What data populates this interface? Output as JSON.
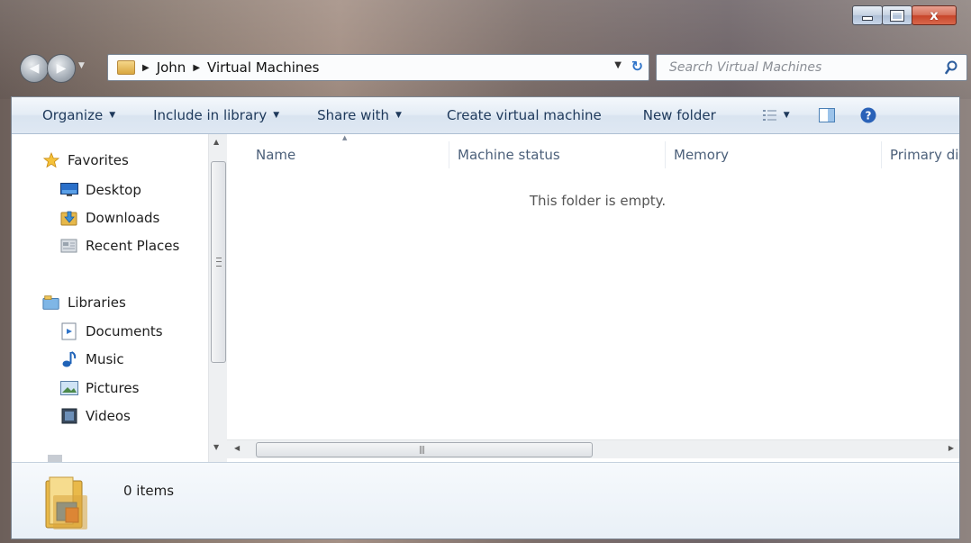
{
  "window": {
    "caption_close": "x"
  },
  "address_bar": {
    "crumbs": [
      "John",
      "Virtual Machines"
    ]
  },
  "search": {
    "placeholder": "Search Virtual Machines"
  },
  "toolbar": {
    "organize": "Organize",
    "include_in_library": "Include in library",
    "share_with": "Share with",
    "create_virtual_machine": "Create virtual machine",
    "new_folder": "New folder"
  },
  "navigation": {
    "favorites": {
      "label": "Favorites",
      "items": [
        "Desktop",
        "Downloads",
        "Recent Places"
      ]
    },
    "libraries": {
      "label": "Libraries",
      "items": [
        "Documents",
        "Music",
        "Pictures",
        "Videos"
      ]
    }
  },
  "content": {
    "columns": [
      "Name",
      "Machine status",
      "Memory",
      "Primary dis"
    ],
    "empty_message": "This folder is empty."
  },
  "details_pane": {
    "status": "0 items"
  },
  "colors": {
    "toolbar_text": "#1e395b",
    "close_button": "#c7452a",
    "refresh_icon": "#2f74c9"
  },
  "icons": {
    "back": "back-arrow-icon",
    "forward": "forward-arrow-icon",
    "refresh": "refresh-icon",
    "search": "search-icon",
    "help": "help-icon"
  }
}
